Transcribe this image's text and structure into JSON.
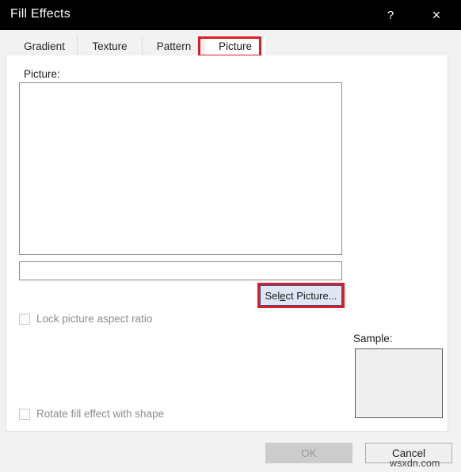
{
  "window": {
    "title": "Fill Effects",
    "help_icon": "question-mark-icon",
    "close_icon": "close-x-icon",
    "help_label": "?",
    "close_label": "×",
    "titlebar_bg": "#000000",
    "titlebar_fg": "#ffffff"
  },
  "tabs": {
    "items": [
      {
        "label": "Gradient",
        "selected": false
      },
      {
        "label": "Texture",
        "selected": false
      },
      {
        "label": "Pattern",
        "selected": false
      },
      {
        "label": "Picture",
        "selected": true
      }
    ],
    "selected_label": "Picture",
    "highlight_color": "#e01b22"
  },
  "main": {
    "picture_label": "Picture:",
    "picture_preview_value": "",
    "path_input_value": "",
    "path_input_placeholder": "",
    "select_picture": {
      "label": "Select Picture...",
      "mnemonic_before": "Sel",
      "mnemonic_char": "e",
      "mnemonic_after": "ct Picture...",
      "highlighted": true,
      "highlight_color": "#e01b22",
      "background": "#dfe7f5",
      "border_color": "#2f5597"
    },
    "checkboxes": [
      {
        "label": "Lock picture aspect ratio",
        "checked": false,
        "enabled": false
      },
      {
        "label": "Rotate fill effect with shape",
        "checked": false,
        "enabled": false
      }
    ],
    "sample_label": "Sample:",
    "sample_fill": "#efefef"
  },
  "footer": {
    "ok_label": "OK",
    "ok_enabled": false,
    "cancel_label": "Cancel",
    "cancel_enabled": true
  },
  "watermark": {
    "text": "wsxdn.com"
  }
}
